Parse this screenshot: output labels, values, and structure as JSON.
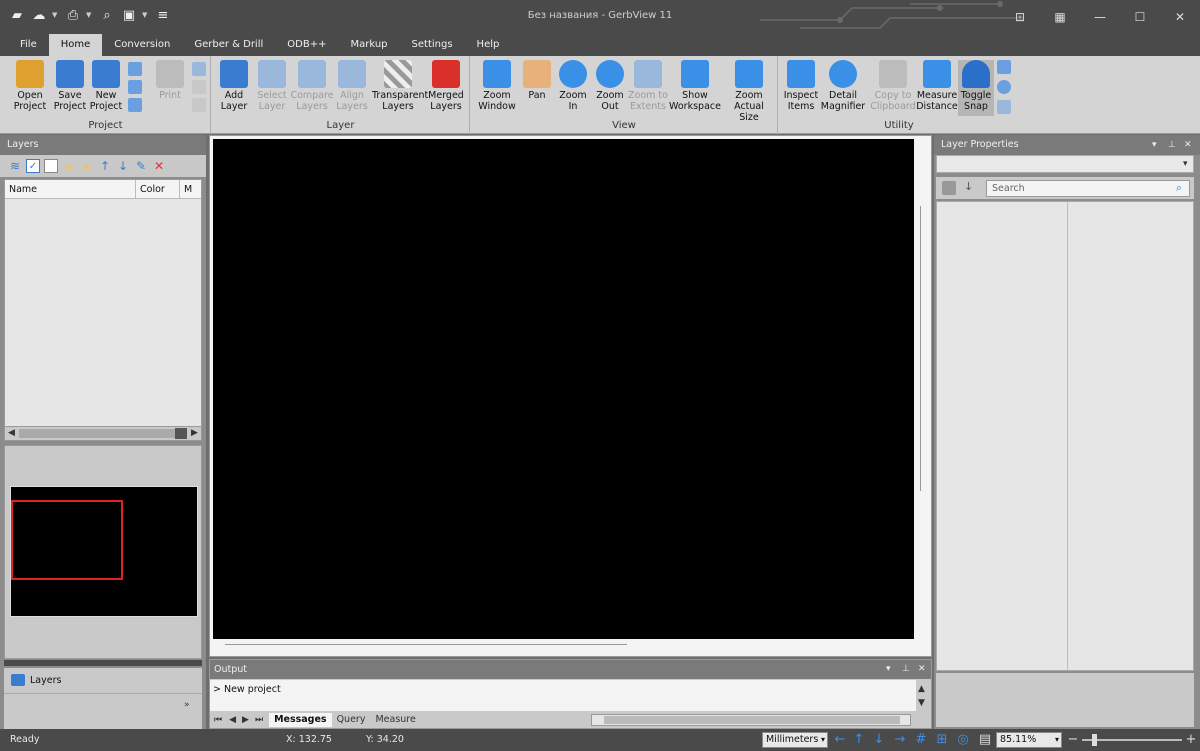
{
  "window": {
    "title": "Без названия - GerbView 11"
  },
  "tabs": [
    "File",
    "Home",
    "Conversion",
    "Gerber & Drill",
    "ODB++",
    "Markup",
    "Settings",
    "Help"
  ],
  "ribbon": {
    "project": {
      "label": "Project",
      "buttons": [
        [
          "Open",
          "Project"
        ],
        [
          "Save",
          "Project"
        ],
        [
          "New",
          "Project"
        ]
      ],
      "print": [
        "Print",
        ""
      ]
    },
    "layer": {
      "label": "Layer",
      "buttons": [
        [
          "Add",
          "Layer"
        ],
        [
          "Select",
          "Layer"
        ],
        [
          "Compare",
          "Layers"
        ],
        [
          "Align",
          "Layers"
        ],
        [
          "Transparent",
          "Layers"
        ],
        [
          "Merged",
          "Layers"
        ]
      ]
    },
    "view": {
      "label": "View",
      "buttons": [
        [
          "Zoom",
          "Window"
        ],
        [
          "Pan",
          ""
        ],
        [
          "Zoom",
          "In"
        ],
        [
          "Zoom",
          "Out"
        ],
        [
          "Zoom to",
          "Extents"
        ],
        [
          "Show",
          "Workspace"
        ],
        [
          "Zoom",
          "Actual Size"
        ]
      ]
    },
    "utility": {
      "label": "Utility",
      "buttons": [
        [
          "Inspect",
          "Items"
        ],
        [
          "Detail",
          "Magnifier"
        ],
        [
          "Copy to",
          "Clipboard"
        ],
        [
          "Measure",
          "Distance"
        ],
        [
          "Toggle",
          "Snap"
        ]
      ]
    }
  },
  "layers_panel": {
    "title": "Layers",
    "columns": [
      "Name",
      "Color",
      "M"
    ],
    "tab_label": "Layers"
  },
  "output": {
    "title": "Output",
    "message": "> New project",
    "tabs": [
      "Messages",
      "Query",
      "Measure"
    ]
  },
  "layer_properties": {
    "title": "Layer Properties",
    "search_placeholder": "Search"
  },
  "status": {
    "ready": "Ready",
    "x": "X: 132.75",
    "y": "Y: 34.20",
    "units": "Millimeters",
    "zoom": "85.11%"
  },
  "colors": {
    "chrome": "#4a4a4a",
    "ribbon": "#d4d4d4",
    "canvas": "#000000",
    "accent": "#3a7dd0",
    "nav_rect": "#dd2222"
  }
}
